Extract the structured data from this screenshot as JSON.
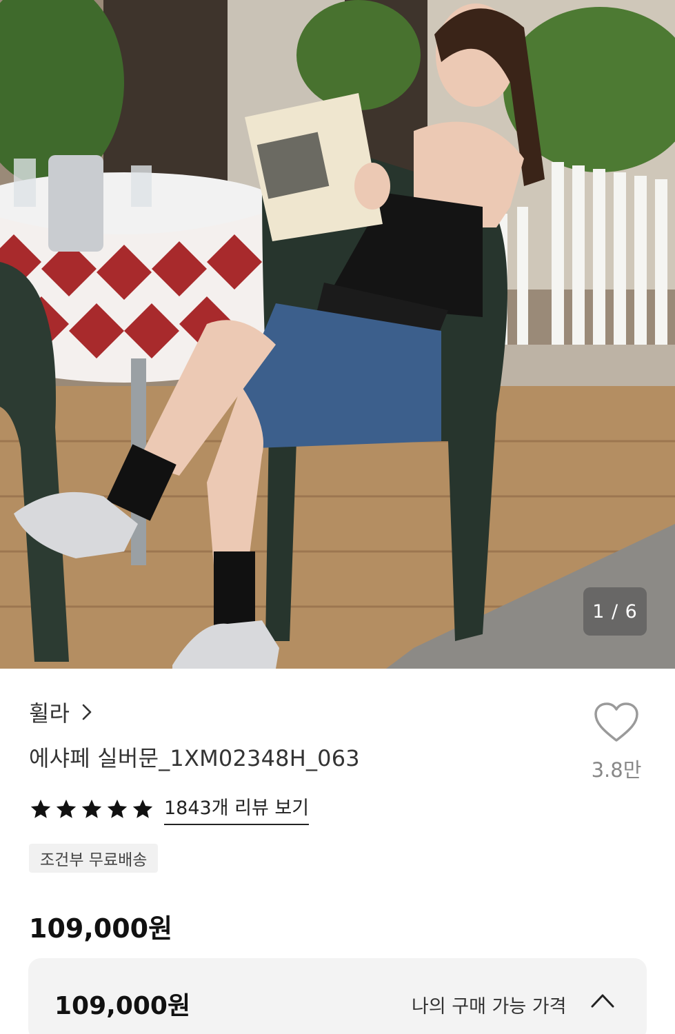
{
  "gallery": {
    "counter": "1 / 6"
  },
  "product": {
    "brand": "휠라",
    "name": "에샤페 실버문_1XM02348H_063",
    "rating_stars": 5,
    "review_link": "1843개 리뷰 보기",
    "shipping_badge": "조건부 무료배송",
    "price": "109,000원"
  },
  "wishlist": {
    "count": "3.8만",
    "icon": "heart-outline-icon"
  },
  "price_box": {
    "price": "109,000원",
    "label": "나의 구매 가능 가격",
    "icon": "chevron-up-icon"
  },
  "colors": {
    "text_primary": "#111111",
    "text_muted": "#888888",
    "badge_bg": "#f1f1f1",
    "price_box_bg": "#f3f3f3"
  }
}
